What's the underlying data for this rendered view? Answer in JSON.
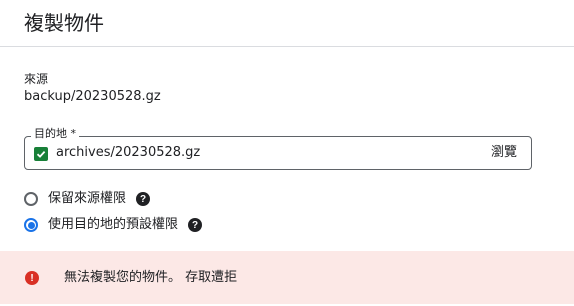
{
  "dialog": {
    "title": "複製物件"
  },
  "source": {
    "label": "來源",
    "value": "backup/20230528.gz"
  },
  "destination": {
    "label": "目的地 *",
    "value": "archives/20230528.gz",
    "valid": true,
    "browse_label": "瀏覽"
  },
  "permissions": {
    "options": [
      {
        "label": "保留來源權限",
        "selected": false
      },
      {
        "label": "使用目的地的預設權限",
        "selected": true
      }
    ]
  },
  "error": {
    "message": "無法複製您的物件。 存取遭拒"
  },
  "colors": {
    "accent": "#1a73e8",
    "success": "#188038",
    "error": "#d93025",
    "error_bg": "#fce8e6"
  }
}
